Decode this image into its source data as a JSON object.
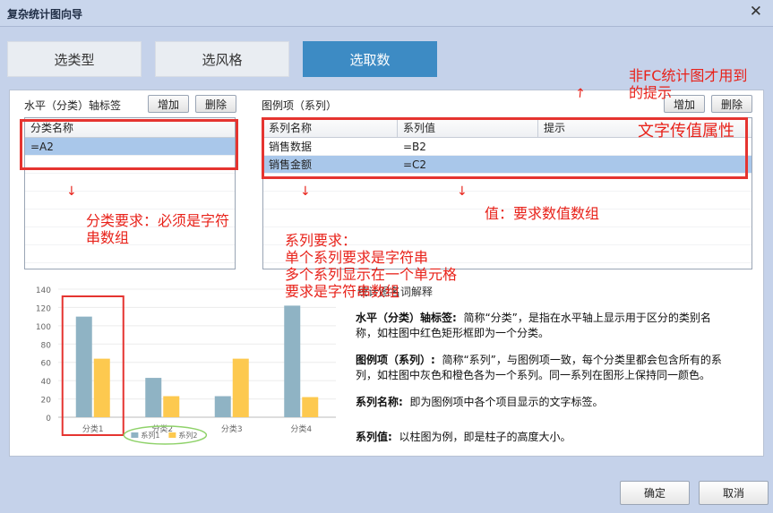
{
  "window": {
    "title": "复杂统计图向导",
    "close_glyph": "✕"
  },
  "tabs": [
    {
      "label": "选类型",
      "active": false
    },
    {
      "label": "选风格",
      "active": false
    },
    {
      "label": "选取数",
      "active": true
    }
  ],
  "category_axis": {
    "label": "水平（分类）轴标签",
    "add_button": "增加",
    "delete_button": "删除",
    "column": "分类名称",
    "rows": [
      "=A2"
    ]
  },
  "legend": {
    "label": "图例项（系列）",
    "add_button": "增加",
    "delete_button": "删除",
    "columns": [
      "系列名称",
      "系列值",
      "提示"
    ],
    "rows": [
      {
        "name": "销售数据",
        "value": "=B2",
        "tip": ""
      },
      {
        "name": "销售金额",
        "value": "=C2",
        "tip": ""
      }
    ]
  },
  "annotations": {
    "fc_tip": "非FC统计图才用到\n的提示",
    "text_attr": "文字传值属性",
    "category_req": "分类要求：必须是字符\n串数组",
    "series_req": "系列要求：\n单个系列要求是字符串\n多个系列显示在一个单元格\n要求是字符串数组",
    "value_req": "值：要求数值数组"
  },
  "explain": {
    "title": "统计图名词解释",
    "items": [
      {
        "term": "水平（分类）轴标签:",
        "text": "简称“分类”，是指在水平轴上显示用于区分的类别名称，如柱图中红色矩形框即为一个分类。"
      },
      {
        "term": "图例项（系列）:",
        "text": "简称“系列”，与图例项一致，每个分类里都会包含所有的系列，如柱图中灰色和橙色各为一个系列。同一系列在图形上保持同一颜色。"
      },
      {
        "term": "系列名称:",
        "text": "即为图例项中各个项目显示的文字标签。"
      },
      {
        "term": "系列值:",
        "text": "以柱图为例，即是柱子的高度大小。"
      }
    ]
  },
  "chart_data": {
    "type": "bar",
    "categories": [
      "分类1",
      "分类2",
      "分类3",
      "分类4"
    ],
    "series": [
      {
        "name": "系列1",
        "color": "#8fb3c4",
        "values": [
          110,
          43,
          23,
          122
        ]
      },
      {
        "name": "系列2",
        "color": "#fdc94f",
        "values": [
          64,
          23,
          64,
          22
        ]
      }
    ],
    "ylim": [
      0,
      140
    ],
    "yticks": [
      0,
      20,
      40,
      60,
      80,
      100,
      120,
      140
    ],
    "grid": true,
    "legend_position": "bottom"
  },
  "footer": {
    "ok": "确定",
    "cancel": "取消"
  }
}
